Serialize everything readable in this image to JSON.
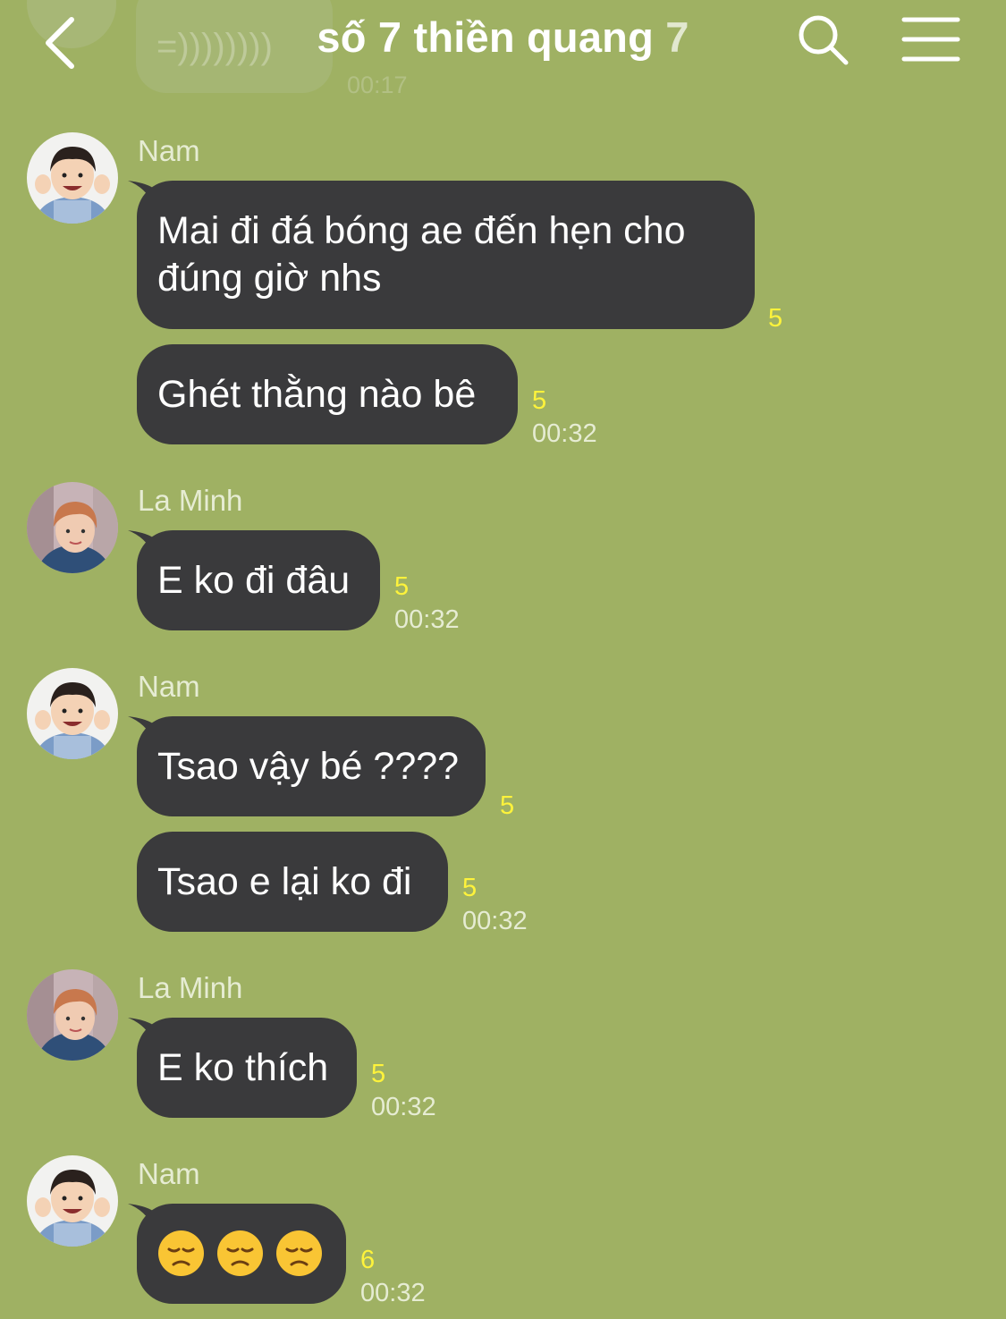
{
  "header": {
    "title": "số 7 thiền quang",
    "member_count": "7",
    "back_icon": "chevron-left-icon",
    "search_icon": "search-icon",
    "menu_icon": "hamburger-menu-icon"
  },
  "previous_message": {
    "text": "=))))))))",
    "time": "00:17"
  },
  "messages": [
    {
      "sender": "Nam",
      "text": "Mai đi đá bóng ae đến hẹn cho đúng giờ nhs",
      "read": "5",
      "time": ""
    },
    {
      "sender": "",
      "text": "Ghét thằng nào bê",
      "read": "5",
      "time": "00:32"
    },
    {
      "sender": "La Minh",
      "text": "E ko đi đâu",
      "read": "5",
      "time": "00:32"
    },
    {
      "sender": "Nam",
      "text": "Tsao vậy bé ????",
      "read": "5",
      "time": ""
    },
    {
      "sender": "",
      "text": "Tsao e lại ko đi",
      "read": "5",
      "time": "00:32"
    },
    {
      "sender": "La Minh",
      "text": "E ko thích",
      "read": "5",
      "time": "00:32"
    },
    {
      "sender": "Nam",
      "text": "😞😞😞",
      "emoji": [
        "disappointed-face",
        "disappointed-face",
        "disappointed-face"
      ],
      "read": "6",
      "time": "00:32"
    }
  ],
  "colors": {
    "background": "#9fb163",
    "bubble": "#3a3a3c",
    "read_count": "#fef33b",
    "meta_text": "#e6ecd3"
  }
}
